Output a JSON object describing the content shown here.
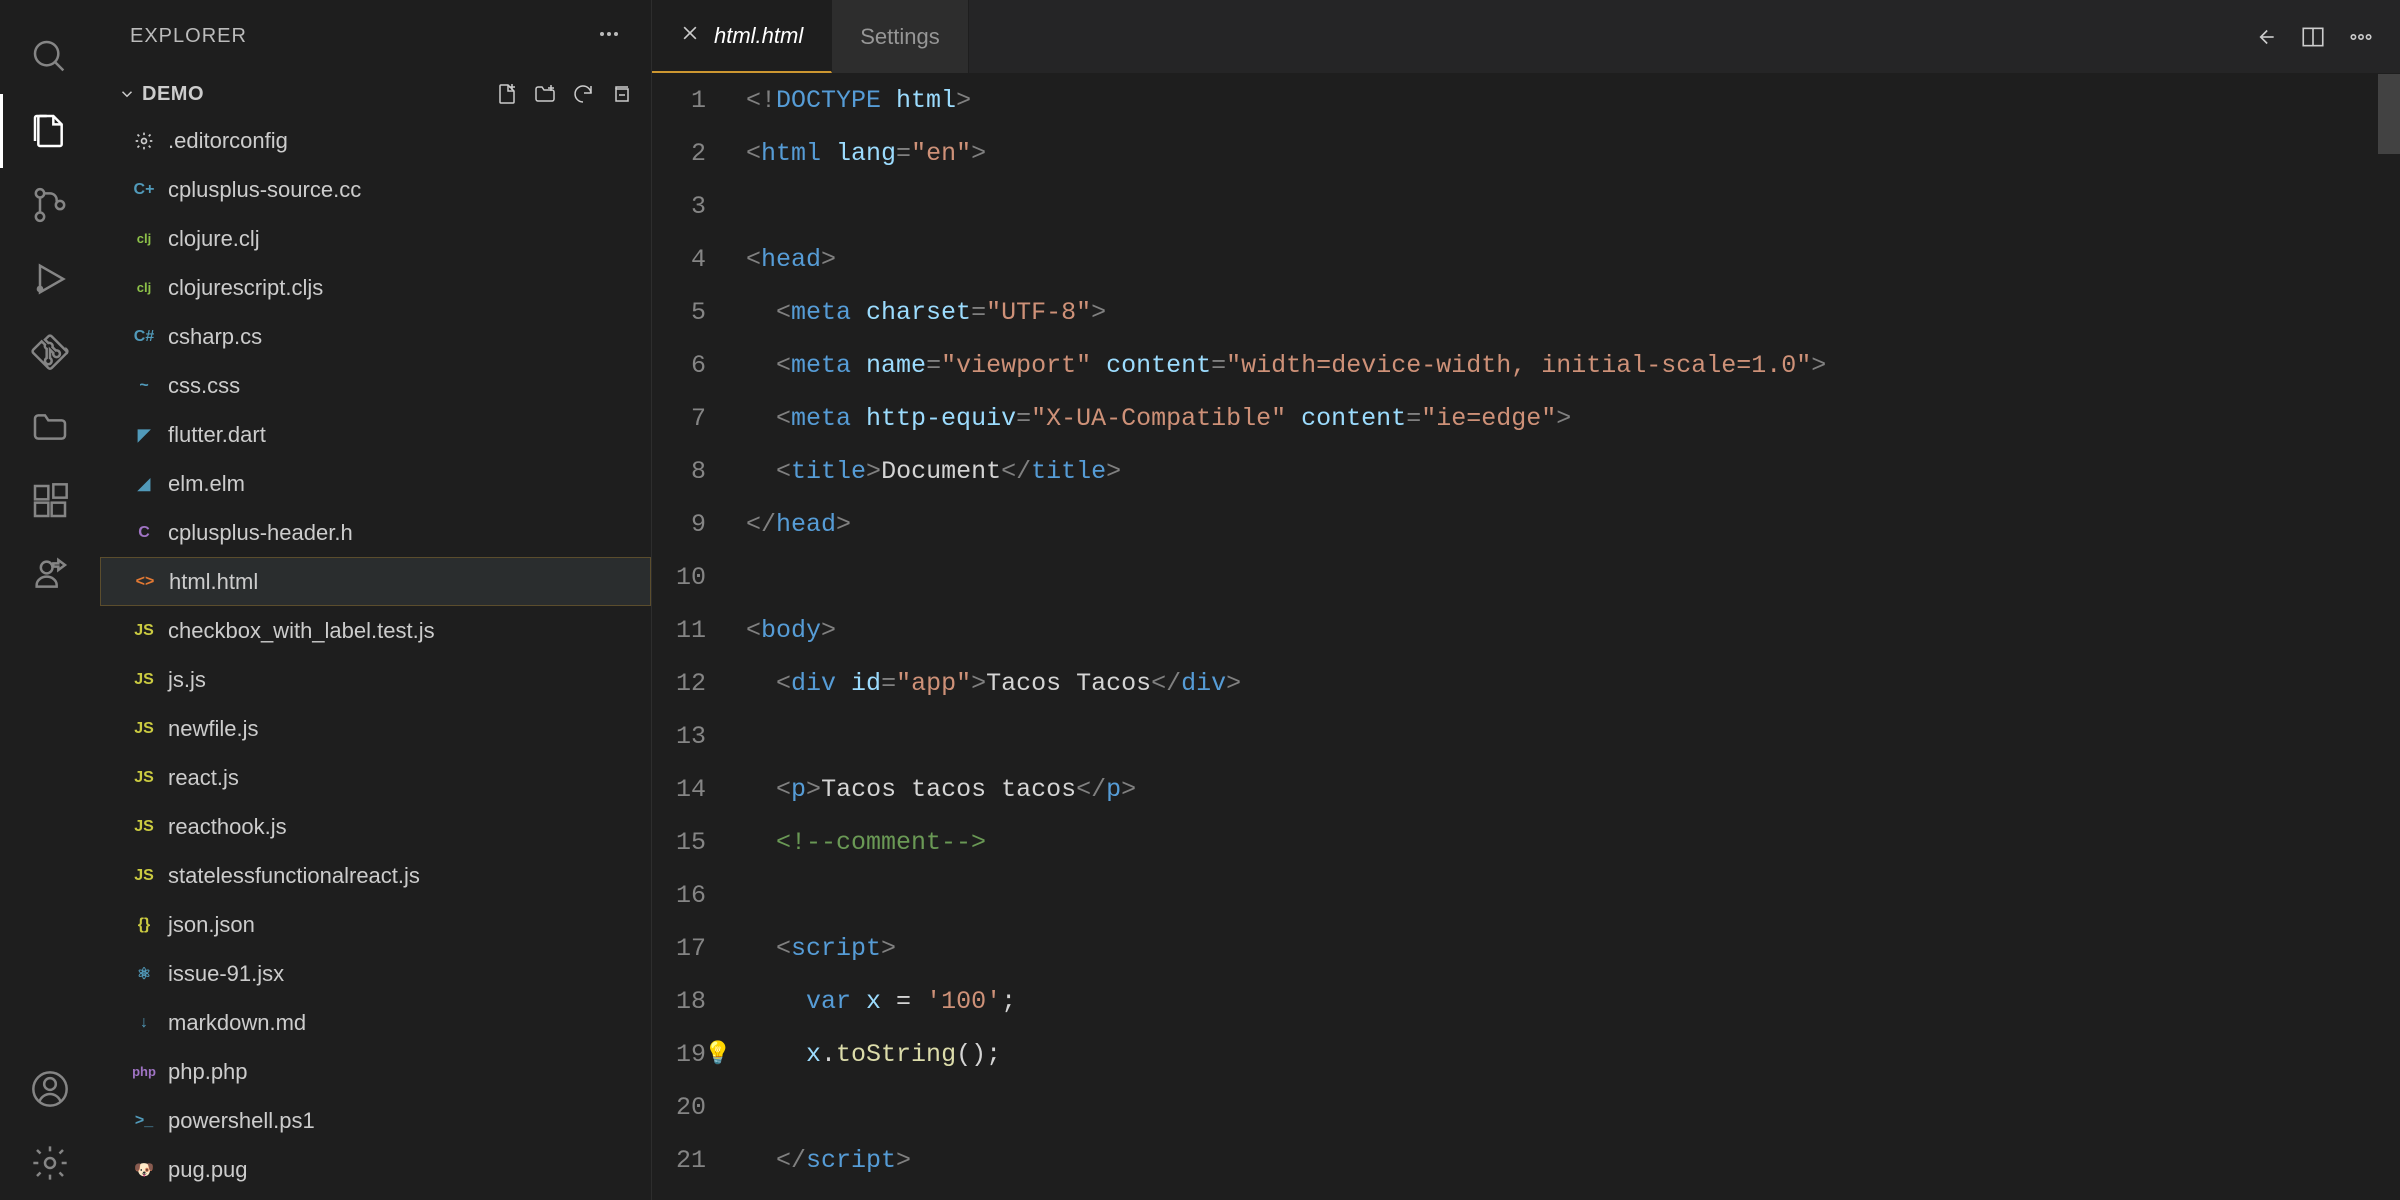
{
  "sidebar": {
    "title": "EXPLORER",
    "folder": "DEMO"
  },
  "files": [
    {
      "name": ".editorconfig",
      "icon": "gear",
      "color": "#cccccc"
    },
    {
      "name": "cplusplus-source.cc",
      "icon": "C+",
      "color": "#519aba"
    },
    {
      "name": "clojure.clj",
      "icon": "clj",
      "color": "#8dc149"
    },
    {
      "name": "clojurescript.cljs",
      "icon": "clj",
      "color": "#8dc149"
    },
    {
      "name": "csharp.cs",
      "icon": "C#",
      "color": "#519aba"
    },
    {
      "name": "css.css",
      "icon": "~",
      "color": "#519aba"
    },
    {
      "name": "flutter.dart",
      "icon": "◤",
      "color": "#519aba"
    },
    {
      "name": "elm.elm",
      "icon": "◢",
      "color": "#519aba"
    },
    {
      "name": "cplusplus-header.h",
      "icon": "C",
      "color": "#a074c4"
    },
    {
      "name": "html.html",
      "icon": "<>",
      "color": "#e37933",
      "selected": true
    },
    {
      "name": "checkbox_with_label.test.js",
      "icon": "JS",
      "color": "#cbcb41"
    },
    {
      "name": "js.js",
      "icon": "JS",
      "color": "#cbcb41"
    },
    {
      "name": "newfile.js",
      "icon": "JS",
      "color": "#cbcb41"
    },
    {
      "name": "react.js",
      "icon": "JS",
      "color": "#cbcb41"
    },
    {
      "name": "reacthook.js",
      "icon": "JS",
      "color": "#cbcb41"
    },
    {
      "name": "statelessfunctionalreact.js",
      "icon": "JS",
      "color": "#cbcb41"
    },
    {
      "name": "json.json",
      "icon": "{}",
      "color": "#cbcb41"
    },
    {
      "name": "issue-91.jsx",
      "icon": "⚛",
      "color": "#519aba"
    },
    {
      "name": "markdown.md",
      "icon": "↓",
      "color": "#519aba"
    },
    {
      "name": "php.php",
      "icon": "php",
      "color": "#a074c4"
    },
    {
      "name": "powershell.ps1",
      "icon": ">_",
      "color": "#519aba"
    },
    {
      "name": "pug.pug",
      "icon": "🐶",
      "color": "#cc6666"
    }
  ],
  "tabs": [
    {
      "label": "html.html",
      "active": true,
      "closable": true,
      "italic": true
    },
    {
      "label": "Settings",
      "active": false,
      "closable": false
    }
  ],
  "code_lines": [
    {
      "n": "1",
      "tokens": [
        [
          "<!",
          "tag"
        ],
        [
          "DOCTYPE ",
          "name"
        ],
        [
          "html",
          "attr"
        ],
        [
          ">",
          "tag"
        ]
      ]
    },
    {
      "n": "2",
      "tokens": [
        [
          "<",
          "tag"
        ],
        [
          "html ",
          "name"
        ],
        [
          "lang",
          "attr"
        ],
        [
          "=",
          "tag"
        ],
        [
          "\"en\"",
          "str"
        ],
        [
          ">",
          "tag"
        ]
      ]
    },
    {
      "n": "3",
      "tokens": []
    },
    {
      "n": "4",
      "tokens": [
        [
          "<",
          "tag"
        ],
        [
          "head",
          "name"
        ],
        [
          ">",
          "tag"
        ]
      ]
    },
    {
      "n": "5",
      "tokens": [
        [
          "  ",
          ""
        ],
        [
          "<",
          "tag"
        ],
        [
          "meta ",
          "name"
        ],
        [
          "charset",
          "attr"
        ],
        [
          "=",
          "tag"
        ],
        [
          "\"UTF-8\"",
          "str"
        ],
        [
          ">",
          "tag"
        ]
      ]
    },
    {
      "n": "6",
      "tokens": [
        [
          "  ",
          ""
        ],
        [
          "<",
          "tag"
        ],
        [
          "meta ",
          "name"
        ],
        [
          "name",
          "attr"
        ],
        [
          "=",
          "tag"
        ],
        [
          "\"viewport\"",
          "str"
        ],
        [
          " ",
          ""
        ],
        [
          "content",
          "attr"
        ],
        [
          "=",
          "tag"
        ],
        [
          "\"width=device-width, initial-scale=1.0\"",
          "str"
        ],
        [
          ">",
          "tag"
        ]
      ]
    },
    {
      "n": "7",
      "tokens": [
        [
          "  ",
          ""
        ],
        [
          "<",
          "tag"
        ],
        [
          "meta ",
          "name"
        ],
        [
          "http-equiv",
          "attr"
        ],
        [
          "=",
          "tag"
        ],
        [
          "\"X-UA-Compatible\"",
          "str"
        ],
        [
          " ",
          ""
        ],
        [
          "content",
          "attr"
        ],
        [
          "=",
          "tag"
        ],
        [
          "\"ie=edge\"",
          "str"
        ],
        [
          ">",
          "tag"
        ]
      ]
    },
    {
      "n": "8",
      "tokens": [
        [
          "  ",
          ""
        ],
        [
          "<",
          "tag"
        ],
        [
          "title",
          "name"
        ],
        [
          ">",
          "tag"
        ],
        [
          "Document",
          "txt"
        ],
        [
          "</",
          "tag"
        ],
        [
          "title",
          "name"
        ],
        [
          ">",
          "tag"
        ]
      ]
    },
    {
      "n": "9",
      "tokens": [
        [
          "</",
          "tag"
        ],
        [
          "head",
          "name"
        ],
        [
          ">",
          "tag"
        ]
      ]
    },
    {
      "n": "10",
      "tokens": []
    },
    {
      "n": "11",
      "tokens": [
        [
          "<",
          "tag"
        ],
        [
          "body",
          "name"
        ],
        [
          ">",
          "tag"
        ]
      ]
    },
    {
      "n": "12",
      "tokens": [
        [
          "  ",
          ""
        ],
        [
          "<",
          "tag"
        ],
        [
          "div ",
          "name"
        ],
        [
          "id",
          "attr"
        ],
        [
          "=",
          "tag"
        ],
        [
          "\"app\"",
          "str"
        ],
        [
          ">",
          "tag"
        ],
        [
          "Tacos Tacos",
          "txt"
        ],
        [
          "</",
          "tag"
        ],
        [
          "div",
          "name"
        ],
        [
          ">",
          "tag"
        ]
      ]
    },
    {
      "n": "13",
      "tokens": []
    },
    {
      "n": "14",
      "tokens": [
        [
          "  ",
          ""
        ],
        [
          "<",
          "tag"
        ],
        [
          "p",
          "name"
        ],
        [
          ">",
          "tag"
        ],
        [
          "Tacos tacos tacos",
          "txt"
        ],
        [
          "</",
          "tag"
        ],
        [
          "p",
          "name"
        ],
        [
          ">",
          "tag"
        ]
      ]
    },
    {
      "n": "15",
      "tokens": [
        [
          "  ",
          ""
        ],
        [
          "<!--comment-->",
          "comm"
        ]
      ]
    },
    {
      "n": "16",
      "tokens": []
    },
    {
      "n": "17",
      "tokens": [
        [
          "  ",
          ""
        ],
        [
          "<",
          "tag"
        ],
        [
          "script",
          "name"
        ],
        [
          ">",
          "tag"
        ]
      ]
    },
    {
      "n": "18",
      "tokens": [
        [
          "    ",
          ""
        ],
        [
          "var ",
          "kw"
        ],
        [
          "x",
          "var"
        ],
        [
          " = ",
          "txt"
        ],
        [
          "'100'",
          "str"
        ],
        [
          ";",
          "txt"
        ]
      ]
    },
    {
      "n": "19",
      "tokens": [
        [
          "    ",
          ""
        ],
        [
          "x",
          "var"
        ],
        [
          ".",
          "txt"
        ],
        [
          "toString",
          "fn"
        ],
        [
          "();",
          "txt"
        ]
      ],
      "bulb": true
    },
    {
      "n": "20",
      "tokens": []
    },
    {
      "n": "21",
      "tokens": [
        [
          "  ",
          ""
        ],
        [
          "</",
          "tag"
        ],
        [
          "script",
          "name"
        ],
        [
          ">",
          "tag"
        ]
      ]
    }
  ]
}
